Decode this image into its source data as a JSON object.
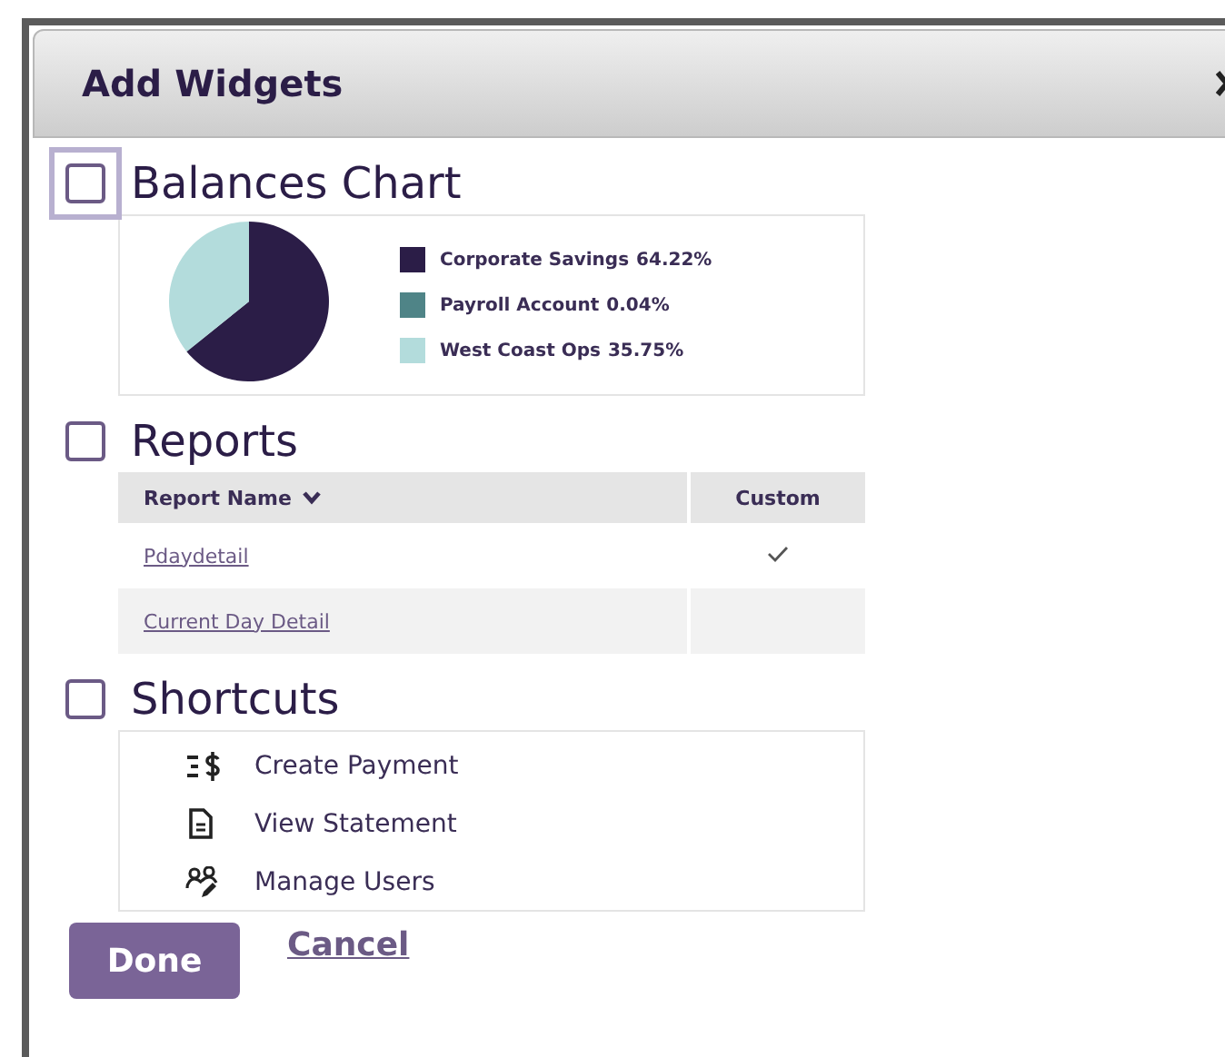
{
  "dialog": {
    "title": "Add Widgets"
  },
  "widgets": [
    {
      "kind": "chart",
      "label": "Balances Chart",
      "checked": false,
      "focused": true,
      "legend": [
        {
          "value": "64.22%",
          "color": "#2b1d47"
        },
        {
          "value": "0.04%",
          "color": "#4f8487"
        },
        {
          "value": "35.75%",
          "color": "#b3dcdc"
        }
      ],
      "chart_data": {
        "type": "pie",
        "categories": [
          "Corporate Savings",
          "Payroll Account",
          "West Coast Ops"
        ],
        "values": [
          64.22,
          0.04,
          35.75
        ]
      }
    },
    {
      "kind": "table",
      "label": "Reports",
      "checked": false,
      "focused": false,
      "columns": [
        {
          "label": "Report Name",
          "sortable": true
        },
        {
          "label": "Custom",
          "sortable": false
        }
      ],
      "rows": [
        {
          "name": "Pdaydetail",
          "custom": true
        },
        {
          "name": "Current Day Detail",
          "custom": false
        }
      ]
    },
    {
      "kind": "shortcuts",
      "label": "Shortcuts",
      "checked": false,
      "focused": false,
      "items": [
        {
          "kind": "payment",
          "label": "Create Payment"
        },
        {
          "kind": "statement",
          "label": "View Statement"
        },
        {
          "kind": "users",
          "label": "Manage Users"
        }
      ]
    }
  ],
  "buttons": {
    "primary": "Done",
    "secondary": "Cancel"
  }
}
